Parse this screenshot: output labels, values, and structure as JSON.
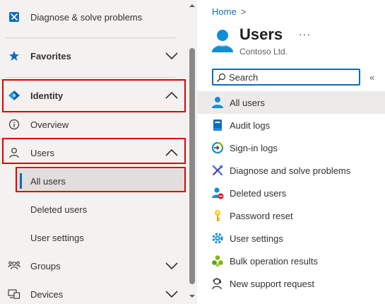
{
  "left_nav": {
    "diagnose_label": "Diagnose & solve problems",
    "favorites_label": "Favorites",
    "identity_label": "Identity",
    "overview_label": "Overview",
    "users_label": "Users",
    "all_users_label": "All users",
    "deleted_users_label": "Deleted users",
    "user_settings_label": "User settings",
    "groups_label": "Groups",
    "devices_label": "Devices"
  },
  "blade": {
    "breadcrumb_home": "Home",
    "breadcrumb_sep": ">",
    "title": "Users",
    "more": "···",
    "subtitle": "Contoso Ltd.",
    "search_placeholder": "Search",
    "collapse": "«",
    "menu": [
      {
        "label": "All users",
        "icon": "user-icon",
        "active": true
      },
      {
        "label": "Audit logs",
        "icon": "audit-log-icon"
      },
      {
        "label": "Sign-in logs",
        "icon": "sign-in-log-icon"
      },
      {
        "label": "Diagnose and solve problems",
        "icon": "wrench-icon"
      },
      {
        "label": "Deleted users",
        "icon": "deleted-user-icon"
      },
      {
        "label": "Password reset",
        "icon": "key-icon"
      },
      {
        "label": "User settings",
        "icon": "user-settings-icon"
      },
      {
        "label": "Bulk operation results",
        "icon": "bulk-operation-icon"
      },
      {
        "label": "New support request",
        "icon": "support-icon"
      }
    ]
  },
  "colors": {
    "accent": "#0f6cbd",
    "highlight_border": "#e00000",
    "nav_background": "#f3f2f1"
  }
}
